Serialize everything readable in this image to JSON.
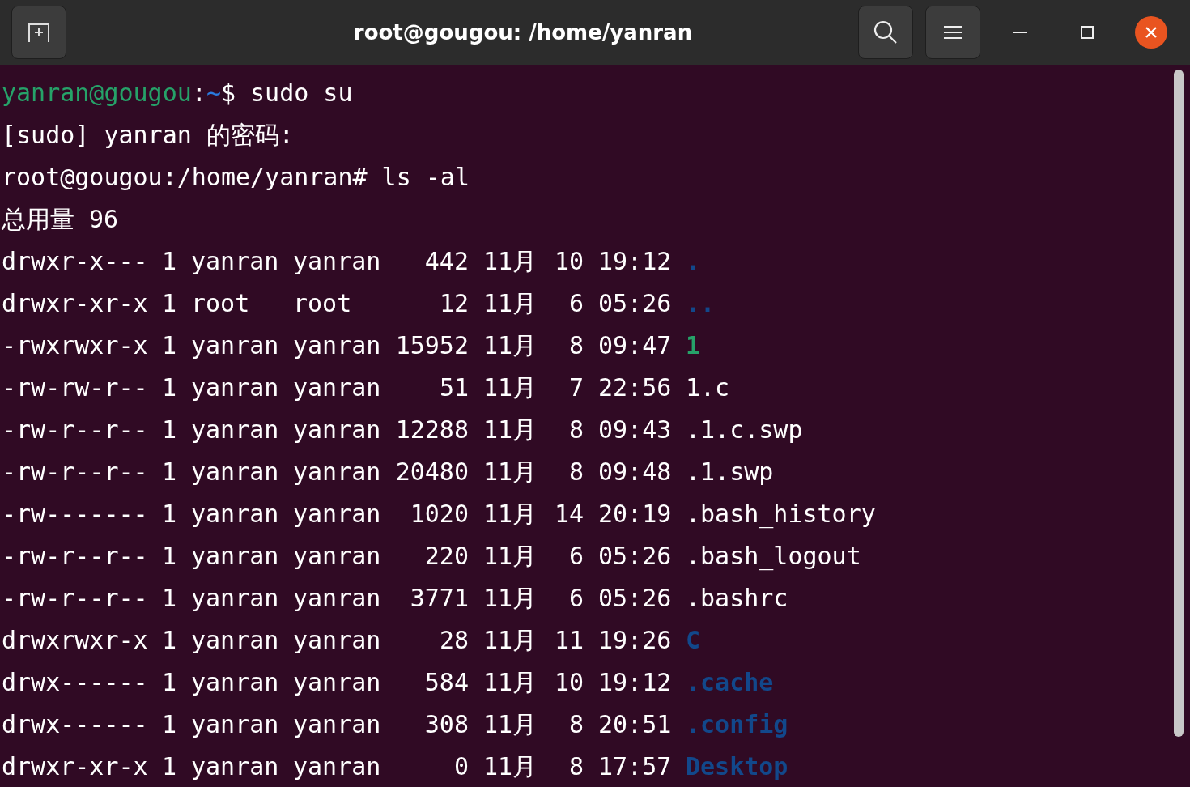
{
  "window": {
    "title": "root@gougou: /home/yanran"
  },
  "lines": [
    {
      "kind": "prompt",
      "segments": [
        {
          "text": "yanran@gougou",
          "color": "#26a269"
        },
        {
          "text": ":"
        },
        {
          "text": "~",
          "color": "#2a7bde"
        },
        {
          "text": "$ sudo su"
        }
      ]
    },
    {
      "kind": "text",
      "text": "[sudo] yanran 的密码:"
    },
    {
      "kind": "text",
      "text": "root@gougou:/home/yanran# ls -al"
    },
    {
      "kind": "text",
      "text": "总用量 96"
    },
    {
      "kind": "entry",
      "permissions": "drwxr-x---",
      "links": "1",
      "owner": "yanran",
      "group": "yanran",
      "size": "442",
      "month": "11月",
      "day": "10",
      "time": "19:12",
      "name": ".",
      "color": "#12488b"
    },
    {
      "kind": "entry",
      "permissions": "drwxr-xr-x",
      "links": "1",
      "owner": "root",
      "group": "root",
      "size": "12",
      "month": "11月",
      "day": "6",
      "time": "05:26",
      "name": "..",
      "color": "#12488b"
    },
    {
      "kind": "entry",
      "permissions": "-rwxrwxr-x",
      "links": "1",
      "owner": "yanran",
      "group": "yanran",
      "size": "15952",
      "month": "11月",
      "day": "8",
      "time": "09:47",
      "name": "1",
      "color": "#26a269"
    },
    {
      "kind": "entry",
      "permissions": "-rw-rw-r--",
      "links": "1",
      "owner": "yanran",
      "group": "yanran",
      "size": "51",
      "month": "11月",
      "day": "7",
      "time": "22:56",
      "name": "1.c"
    },
    {
      "kind": "entry",
      "permissions": "-rw-r--r--",
      "links": "1",
      "owner": "yanran",
      "group": "yanran",
      "size": "12288",
      "month": "11月",
      "day": "8",
      "time": "09:43",
      "name": ".1.c.swp"
    },
    {
      "kind": "entry",
      "permissions": "-rw-r--r--",
      "links": "1",
      "owner": "yanran",
      "group": "yanran",
      "size": "20480",
      "month": "11月",
      "day": "8",
      "time": "09:48",
      "name": ".1.swp"
    },
    {
      "kind": "entry",
      "permissions": "-rw-------",
      "links": "1",
      "owner": "yanran",
      "group": "yanran",
      "size": "1020",
      "month": "11月",
      "day": "14",
      "time": "20:19",
      "name": ".bash_history"
    },
    {
      "kind": "entry",
      "permissions": "-rw-r--r--",
      "links": "1",
      "owner": "yanran",
      "group": "yanran",
      "size": "220",
      "month": "11月",
      "day": "6",
      "time": "05:26",
      "name": ".bash_logout"
    },
    {
      "kind": "entry",
      "permissions": "-rw-r--r--",
      "links": "1",
      "owner": "yanran",
      "group": "yanran",
      "size": "3771",
      "month": "11月",
      "day": "6",
      "time": "05:26",
      "name": ".bashrc"
    },
    {
      "kind": "entry",
      "permissions": "drwxrwxr-x",
      "links": "1",
      "owner": "yanran",
      "group": "yanran",
      "size": "28",
      "month": "11月",
      "day": "11",
      "time": "19:26",
      "name": "C",
      "color": "#12488b"
    },
    {
      "kind": "entry",
      "permissions": "drwx------",
      "links": "1",
      "owner": "yanran",
      "group": "yanran",
      "size": "584",
      "month": "11月",
      "day": "10",
      "time": "19:12",
      "name": ".cache",
      "color": "#12488b"
    },
    {
      "kind": "entry",
      "permissions": "drwx------",
      "links": "1",
      "owner": "yanran",
      "group": "yanran",
      "size": "308",
      "month": "11月",
      "day": "8",
      "time": "20:51",
      "name": ".config",
      "color": "#12488b"
    },
    {
      "kind": "entry",
      "permissions": "drwxr-xr-x",
      "links": "1",
      "owner": "yanran",
      "group": "yanran",
      "size": "0",
      "month": "11月",
      "day": "8",
      "time": "17:57",
      "name": "Desktop",
      "color": "#12488b"
    }
  ]
}
